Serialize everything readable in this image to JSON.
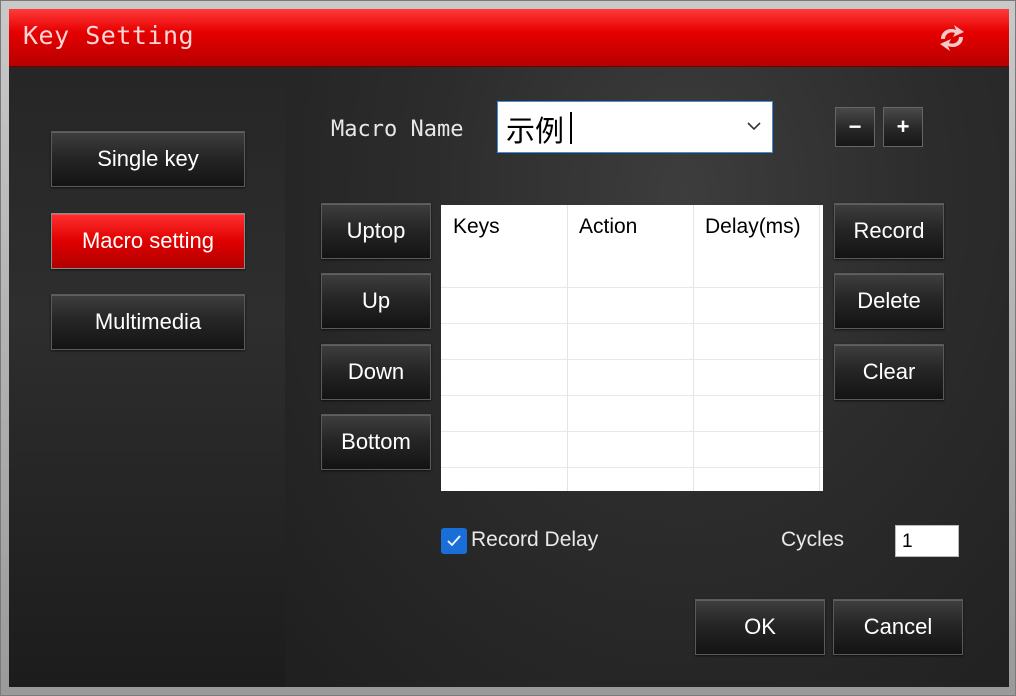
{
  "window": {
    "title": "Key Setting",
    "refresh_icon": "refresh-arrows-icon",
    "accent": "#e60000"
  },
  "sidebar": {
    "items": [
      {
        "label": "Single key",
        "active": false
      },
      {
        "label": "Macro setting",
        "active": true
      },
      {
        "label": "Multimedia",
        "active": false
      }
    ]
  },
  "macro": {
    "name_label": "Macro Name",
    "name_value": "示例",
    "dropdown_icon": "chevron-down-icon",
    "remove_label": "−",
    "add_label": "+"
  },
  "order_buttons": {
    "uptop": "Uptop",
    "up": "Up",
    "down": "Down",
    "bottom": "Bottom"
  },
  "table": {
    "columns": [
      "Keys",
      "Action",
      "Delay(ms)"
    ],
    "rows": []
  },
  "record_buttons": {
    "record": "Record",
    "delete": "Delete",
    "clear": "Clear"
  },
  "options": {
    "record_delay_label": "Record Delay",
    "record_delay_checked": true,
    "cycles_label": "Cycles",
    "cycles_value": "1"
  },
  "footer": {
    "ok_label": "OK",
    "cancel_label": "Cancel"
  }
}
